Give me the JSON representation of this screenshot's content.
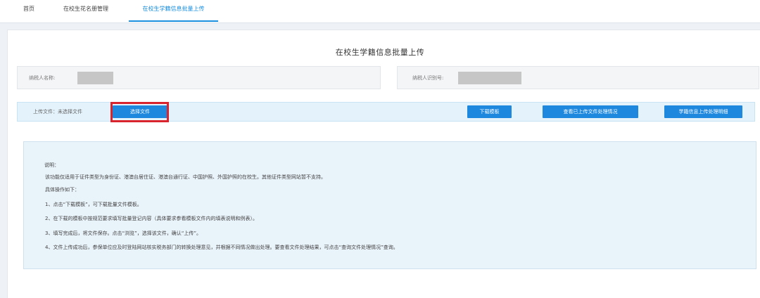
{
  "nav": {
    "tabs": [
      {
        "label": "首页"
      },
      {
        "label": "在校生花名册管理"
      },
      {
        "label": "在校生学籍信息批量上传"
      }
    ],
    "active_tab": 2,
    "accent_color": "#1a8fe0"
  },
  "page": {
    "title": "在校生学籍信息批量上传"
  },
  "info": {
    "taxpayer_name_label": "纳税人名称:",
    "taxpayer_id_label": "纳税人识别号:"
  },
  "upload": {
    "label": "上传文件：未选择文件",
    "choose_file": "选择文件",
    "download_template": "下载模板",
    "view_uploaded": "查看已上传文件处理情况",
    "details": "学籍信息上传处理明细"
  },
  "notice": {
    "heading": "说明：",
    "lines": [
      "该功能仅适用于证件类型为身份证、港澳台居住证、港澳台通行证、中国护照、外国护照的在校生。其他证件类型网站暂不支持。",
      "具体操作如下：",
      "1、点击“下载模板”，可下载批量文件模板。",
      "2、在下载的模板中按规范要求填写批量登记内容（具体要求参看模板文件内的填表说明和例表）。",
      "3、填写完成后，将文件保存。点击“浏览”，选择该文件，确认“上传”。",
      "4、文件上传成功后，参保单位应及时登陆网站核实税务部门的转换处理意见，并根据不同情况做出处理。要查看文件处理结果，可点击“查询文件处理情况”查询。"
    ]
  },
  "colors": {
    "primary_button": "#1e88df",
    "highlight_border": "#d9232d",
    "upload_bar_bg": "#e3f2fb",
    "notice_bg": "#e9f3fa"
  }
}
